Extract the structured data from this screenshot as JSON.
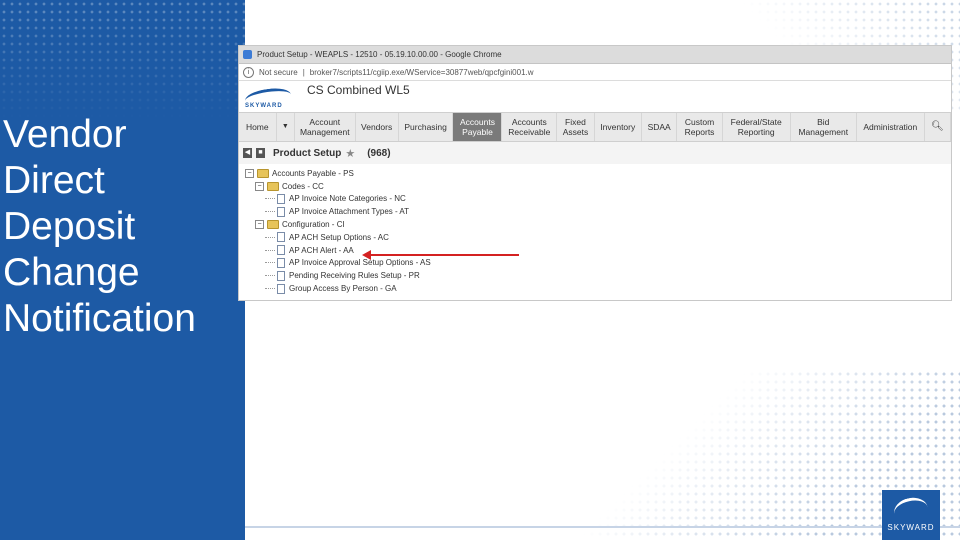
{
  "slide": {
    "title_lines": [
      "Vendor",
      "Direct",
      "Deposit",
      "Change",
      "Notification"
    ]
  },
  "browser": {
    "window_title": "Product Setup - WEAPLS - 12510 - 05.19.10.00.00 - Google Chrome",
    "security": "Not secure",
    "url": "broker7/scripts11/cgiip.exe/WService=30877web/qpcfgini001.w"
  },
  "app": {
    "logo_text": "SKYWARD",
    "name": "CS Combined WL5"
  },
  "menu": [
    {
      "label": "Home",
      "active": false
    },
    {
      "label": "Account Management",
      "active": false
    },
    {
      "label": "Vendors",
      "active": false
    },
    {
      "label": "Purchasing",
      "active": false
    },
    {
      "label": "Accounts Payable",
      "active": true
    },
    {
      "label": "Accounts Receivable",
      "active": false
    },
    {
      "label": "Fixed Assets",
      "active": false
    },
    {
      "label": "Inventory",
      "active": false
    },
    {
      "label": "SDAA",
      "active": false
    },
    {
      "label": "Custom Reports",
      "active": false
    },
    {
      "label": "Federal/State Reporting",
      "active": false
    },
    {
      "label": "Bid Management",
      "active": false
    },
    {
      "label": "Administration",
      "active": false
    }
  ],
  "product_setup": {
    "title": "Product Setup",
    "count": "(968)"
  },
  "tree": [
    "Accounts Payable - PS",
    "Codes - CC",
    "AP Invoice Note Categories - NC",
    "AP Invoice Attachment Types - AT",
    "Configuration - CI",
    "AP ACH Setup Options - AC",
    "AP ACH Alert - AA",
    "AP Invoice Approval Setup Options - AS",
    "Pending Receiving Rules Setup - PR",
    "Group Access By Person - GA"
  ],
  "branding": {
    "corner_logo_text": "SKYWARD"
  },
  "colors": {
    "brand_blue": "#1d5aa5",
    "pointer_arrow": "#d42121",
    "active_menu": "#7a7a7a"
  }
}
